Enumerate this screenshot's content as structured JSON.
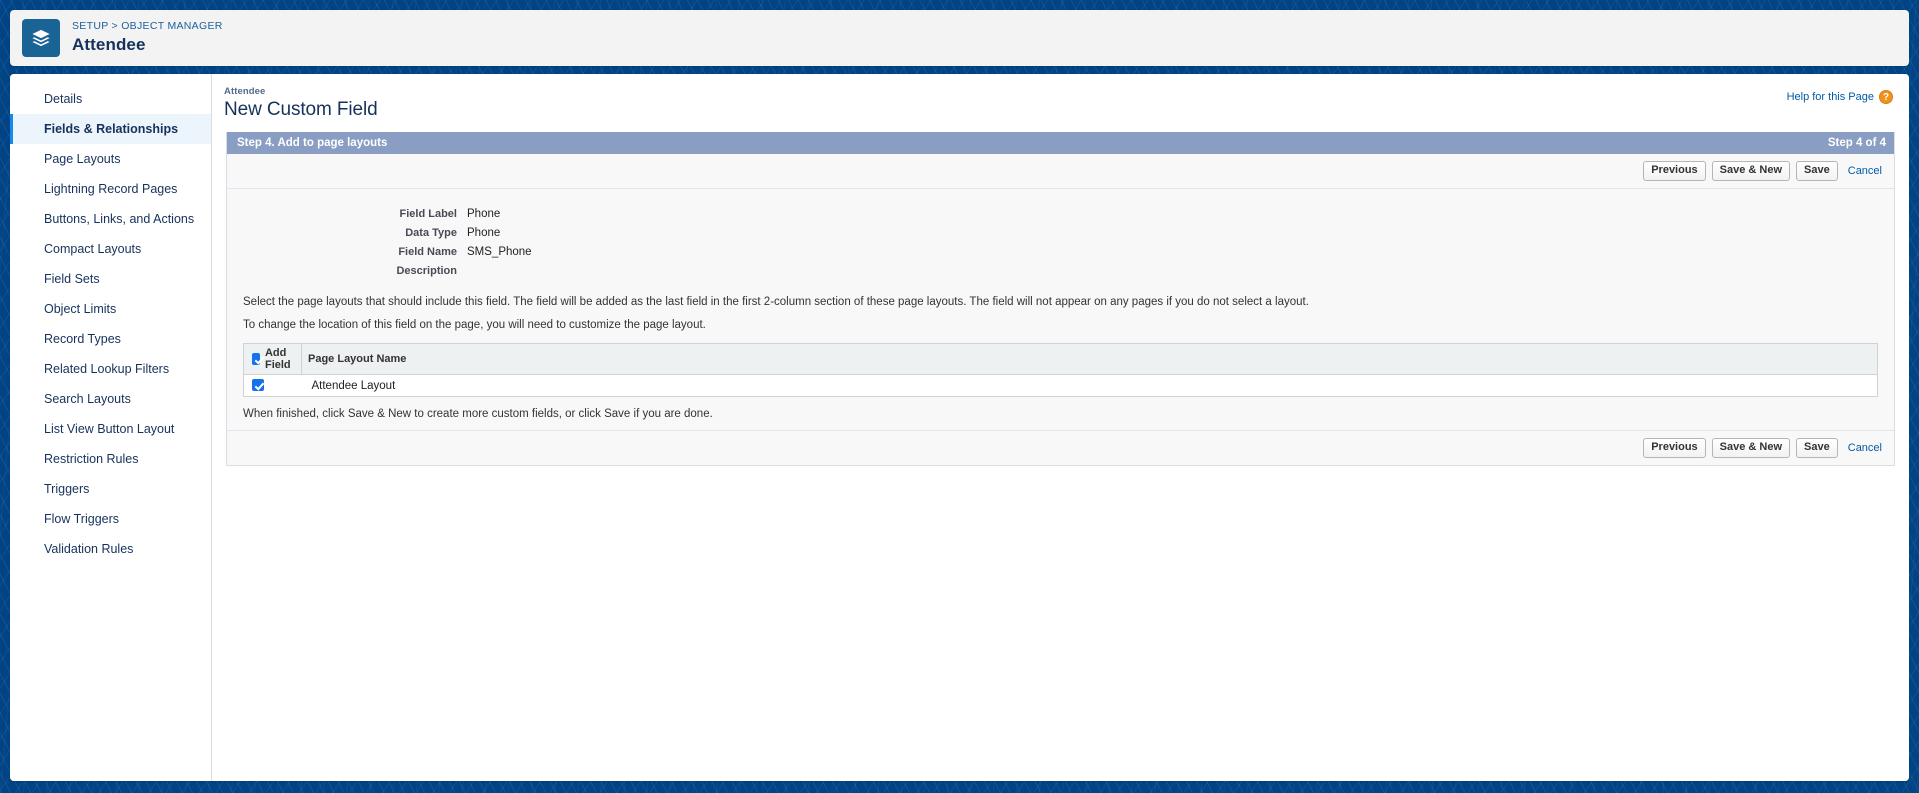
{
  "header": {
    "breadcrumb": "SETUP > OBJECT MANAGER",
    "breadcrumb_setup": "SETUP",
    "breadcrumb_sep": ">",
    "breadcrumb_object_manager": "OBJECT MANAGER",
    "object_title": "Attendee",
    "icon": "layers-stack-icon",
    "icon_bg": "#1a6395"
  },
  "sidebar": {
    "items": [
      {
        "label": "Details",
        "active": false
      },
      {
        "label": "Fields & Relationships",
        "active": true
      },
      {
        "label": "Page Layouts",
        "active": false
      },
      {
        "label": "Lightning Record Pages",
        "active": false
      },
      {
        "label": "Buttons, Links, and Actions",
        "active": false
      },
      {
        "label": "Compact Layouts",
        "active": false
      },
      {
        "label": "Field Sets",
        "active": false
      },
      {
        "label": "Object Limits",
        "active": false
      },
      {
        "label": "Record Types",
        "active": false
      },
      {
        "label": "Related Lookup Filters",
        "active": false
      },
      {
        "label": "Search Layouts",
        "active": false
      },
      {
        "label": "List View Button Layout",
        "active": false
      },
      {
        "label": "Restriction Rules",
        "active": false
      },
      {
        "label": "Triggers",
        "active": false
      },
      {
        "label": "Flow Triggers",
        "active": false
      },
      {
        "label": "Validation Rules",
        "active": false
      }
    ]
  },
  "content": {
    "eyebrow": "Attendee",
    "title": "New Custom Field",
    "help_label": "Help for this Page",
    "help_badge": "?"
  },
  "wizard": {
    "step_title": "Step 4. Add to page layouts",
    "step_counter": "Step 4 of 4",
    "buttons": {
      "previous": "Previous",
      "save_new": "Save & New",
      "save": "Save",
      "cancel": "Cancel"
    }
  },
  "field_summary": [
    {
      "label": "Field Label",
      "value": "Phone"
    },
    {
      "label": "Data Type",
      "value": "Phone"
    },
    {
      "label": "Field Name",
      "value": "SMS_Phone"
    },
    {
      "label": "Description",
      "value": ""
    }
  ],
  "instructions": {
    "para1": "Select the page layouts that should include this field. The field will be added as the last field in the first 2-column section of these page layouts. The field will not appear on any pages if you do not select a layout.",
    "para2": "To change the location of this field on the page, you will need to customize the page layout.",
    "para3": "When finished, click Save & New to create more custom fields, or click Save if you are done."
  },
  "layouts_table": {
    "columns": [
      "Add Field",
      "Page Layout Name"
    ],
    "header_checkbox_checked": true,
    "rows": [
      {
        "checked": true,
        "name": "Attendee Layout"
      }
    ]
  },
  "colors": {
    "banner_blue": "#014486",
    "step_bar": "#8a9dc2",
    "link_blue": "#015ba7",
    "active_nav": "#ecf4fc",
    "accent_bar": "#1589ee",
    "checkbox_blue": "#1672ec",
    "help_orange": "#f0921d"
  }
}
